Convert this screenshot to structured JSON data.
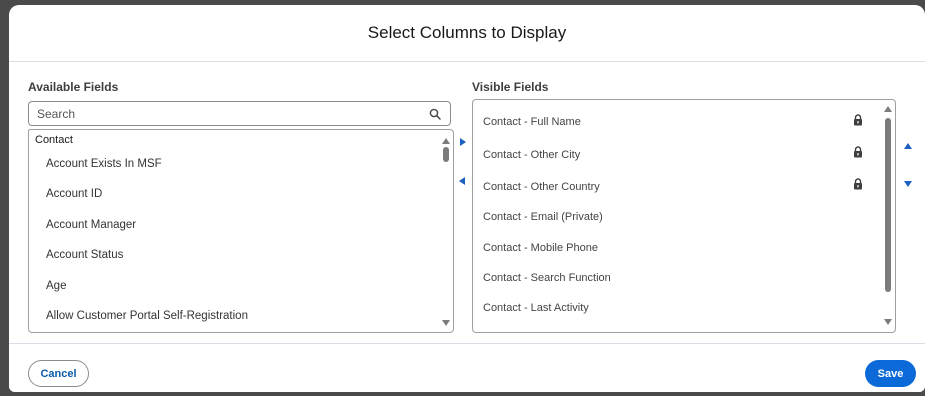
{
  "modal": {
    "title": "Select Columns to Display"
  },
  "available": {
    "label": "Available Fields",
    "search_placeholder": "Search",
    "group": "Contact",
    "items": [
      "Account Exists In MSF",
      "Account ID",
      "Account Manager",
      "Account Status",
      "Age",
      "Allow Customer Portal Self-Registration"
    ]
  },
  "visible": {
    "label": "Visible Fields",
    "items": [
      {
        "label": "Contact - Full Name",
        "locked": true
      },
      {
        "label": "Contact - Other City",
        "locked": true
      },
      {
        "label": "Contact - Other Country",
        "locked": true
      },
      {
        "label": "Contact - Email (Private)",
        "locked": false
      },
      {
        "label": "Contact - Mobile Phone",
        "locked": false
      },
      {
        "label": "Contact - Search Function",
        "locked": false
      },
      {
        "label": "Contact - Last Activity",
        "locked": false
      }
    ]
  },
  "footer": {
    "cancel_label": "Cancel",
    "save_label": "Save"
  },
  "colors": {
    "brand": "#0b6ad8",
    "link": "#0b5cab",
    "arrow": "#1b5fbf"
  }
}
